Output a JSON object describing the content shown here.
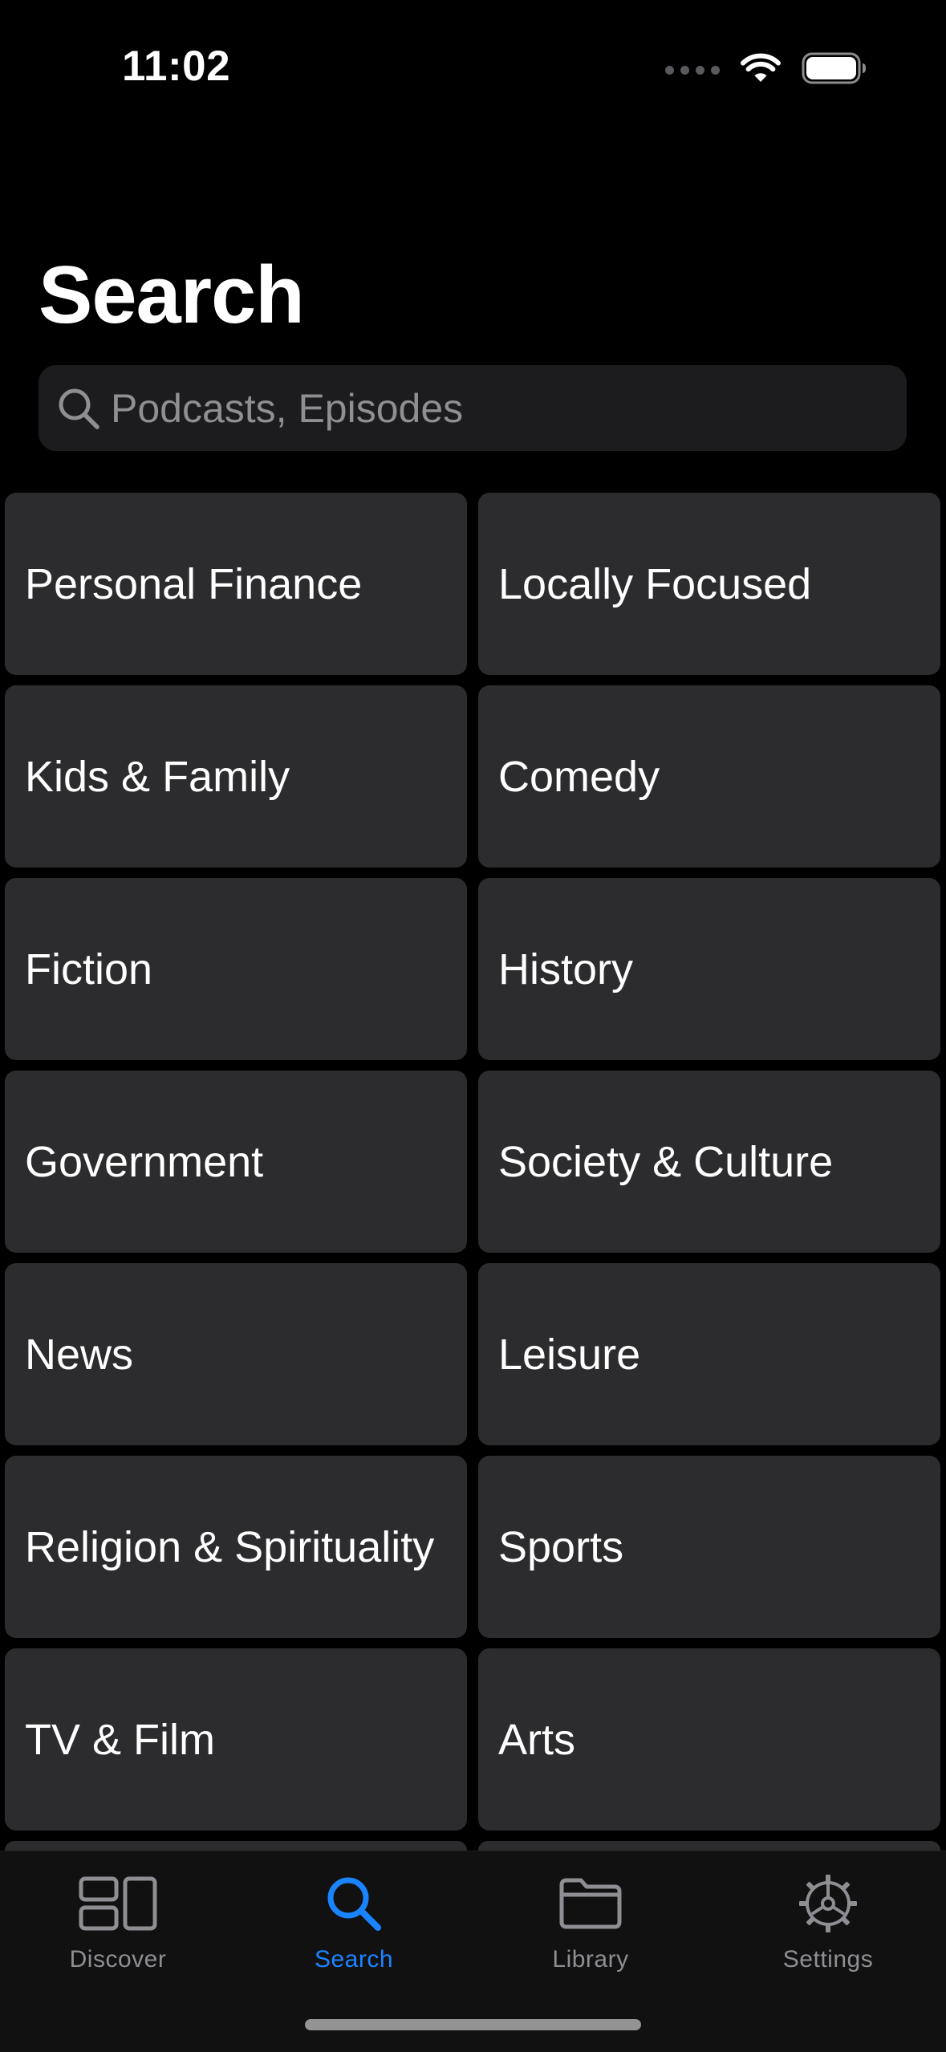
{
  "status_bar": {
    "time": "11:02"
  },
  "header": {
    "title": "Search"
  },
  "search": {
    "placeholder": "Podcasts, Episodes",
    "value": ""
  },
  "categories": [
    {
      "label": "Personal Finance"
    },
    {
      "label": "Locally Focused"
    },
    {
      "label": "Kids & Family"
    },
    {
      "label": "Comedy"
    },
    {
      "label": "Fiction"
    },
    {
      "label": "History"
    },
    {
      "label": "Government"
    },
    {
      "label": "Society & Culture"
    },
    {
      "label": "News"
    },
    {
      "label": "Leisure"
    },
    {
      "label": "Religion & Spirituality"
    },
    {
      "label": "Sports"
    },
    {
      "label": "TV & Film"
    },
    {
      "label": "Arts"
    }
  ],
  "tab_bar": {
    "tabs": [
      {
        "label": "Discover",
        "icon": "discover-icon",
        "active": false
      },
      {
        "label": "Search",
        "icon": "search-icon",
        "active": true
      },
      {
        "label": "Library",
        "icon": "folder-icon",
        "active": false
      },
      {
        "label": "Settings",
        "icon": "gear-icon",
        "active": false
      }
    ]
  },
  "colors": {
    "background": "#000000",
    "tile": "#2c2c2e",
    "search_field": "#1c1c1e",
    "accent": "#1a84ff",
    "inactive": "#8e8e93"
  }
}
